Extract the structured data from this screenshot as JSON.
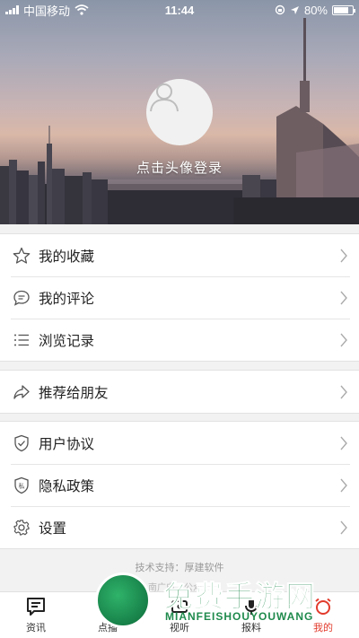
{
  "status_bar": {
    "carrier": "中国移动",
    "time": "11:44",
    "battery": "80%",
    "battery_level": 0.8
  },
  "header": {
    "login_prompt": "点击头像登录"
  },
  "menu_groups": [
    [
      {
        "label": "我的收藏",
        "icon": "star-icon"
      },
      {
        "label": "我的评论",
        "icon": "comment-icon"
      },
      {
        "label": "浏览记录",
        "icon": "list-icon"
      }
    ],
    [
      {
        "label": "推荐给朋友",
        "icon": "share-icon"
      }
    ],
    [
      {
        "label": "用户协议",
        "icon": "shield-check-icon"
      },
      {
        "label": "隐私政策",
        "icon": "privacy-shield-icon"
      },
      {
        "label": "设置",
        "icon": "gear-icon"
      }
    ]
  ],
  "footer": {
    "tech_support": "技术支持：厚建软件",
    "partial_line": "南广电…公众号"
  },
  "tabbar": {
    "items": [
      {
        "label": "资讯",
        "icon": "news-icon",
        "active": false
      },
      {
        "label": "点播",
        "icon": "vod-icon",
        "active": false
      },
      {
        "label": "视听",
        "icon": "av-icon",
        "active": false
      },
      {
        "label": "报料",
        "icon": "mic-icon",
        "active": false
      },
      {
        "label": "我的",
        "icon": "alarm-clock-icon",
        "active": true
      }
    ],
    "active_color": "#e23b2c"
  },
  "watermark": {
    "title": "免费手游网",
    "subtitle": "MIANFEISHOUYOUWANG"
  }
}
